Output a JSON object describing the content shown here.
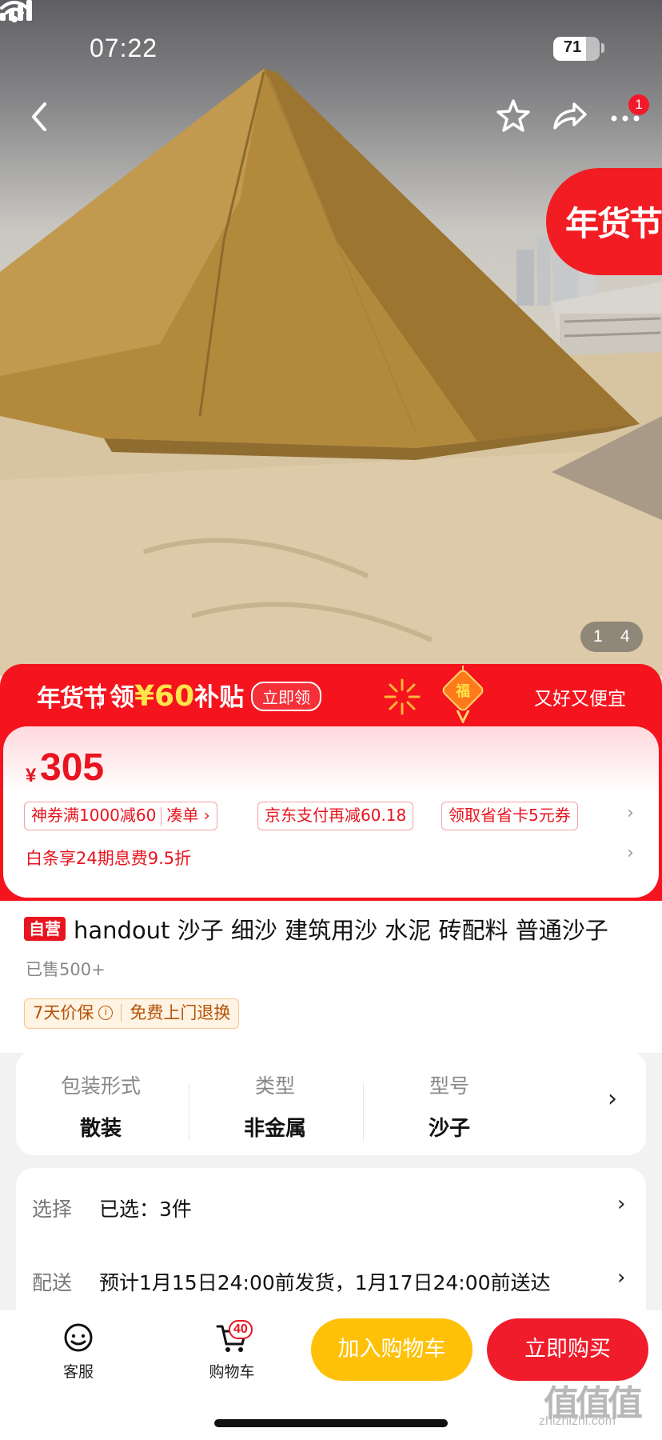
{
  "status_bar": {
    "time": "07:22",
    "battery": "71"
  },
  "nav": {
    "notification_count": "1"
  },
  "hero": {
    "festival_tag": "年货节",
    "page_current": "1",
    "page_total": "4"
  },
  "promo": {
    "title": "年货节",
    "subsidy_prefix": "领",
    "subsidy_amount": "¥60",
    "subsidy_suffix": "补贴",
    "claim_label": "立即领",
    "slogan": "又好又便宜"
  },
  "price": {
    "currency": "¥",
    "value": "305"
  },
  "coupons": [
    {
      "text": "神券满1000减60",
      "action": "凑单 ›"
    },
    {
      "text": "京东支付再减60.18"
    },
    {
      "text": "领取省省卡5元券"
    }
  ],
  "baitiao": "白条享24期息费9.5折",
  "product": {
    "self_operated_tag": "自营",
    "title": "handout 沙子 细沙 建筑用沙 水泥 砖配料 普通沙子",
    "sold": "已售500+",
    "guarantee_left": "7天价保",
    "guarantee_right": "免费上门退换"
  },
  "specs": [
    {
      "label": "包装形式",
      "value": "散装"
    },
    {
      "label": "类型",
      "value": "非金属"
    },
    {
      "label": "型号",
      "value": "沙子"
    }
  ],
  "options": {
    "select_label": "选择",
    "select_value": "已选：3件",
    "delivery_label": "配送",
    "delivery_value": "预计1月15日24:00前发货，1月17日24:00前送达"
  },
  "bottom": {
    "service_label": "客服",
    "cart_label": "购物车",
    "cart_count": "40",
    "add_to_cart": "加入购物车",
    "buy_now": "立即购买"
  },
  "watermark": {
    "logo": "值值值",
    "url": "zhizhizhi.com"
  },
  "colors": {
    "accent_red": "#f01b2b",
    "cart_yellow": "#ffc107"
  }
}
